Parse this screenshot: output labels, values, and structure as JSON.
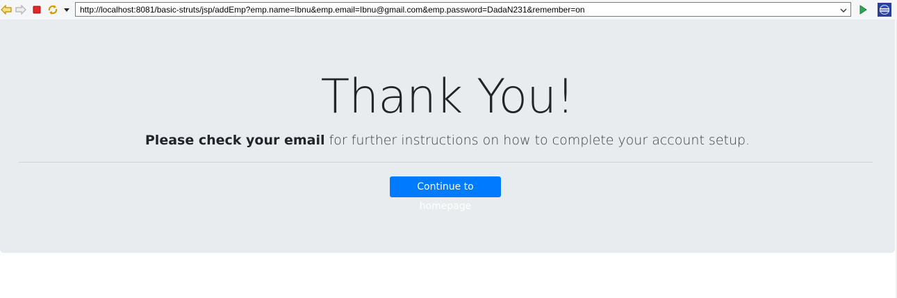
{
  "browser": {
    "url": "http://localhost:8081/basic-struts/jsp/addEmp?emp.name=Ibnu&emp.email=Ibnu@gmail.com&emp.password=DadaN231&remember=on",
    "icons": [
      "back-icon",
      "forward-icon",
      "stop-icon",
      "refresh-icon",
      "dropdown-icon",
      "go-icon",
      "eclipse-icon"
    ]
  },
  "page": {
    "title": "Thank You!",
    "lead_strong": "Please check your email",
    "lead_rest": " for further instructions on how to complete your account setup.",
    "button_label": "Continue to homepage"
  },
  "colors": {
    "jumbotron_bg": "#e9ecef",
    "primary": "#007bff",
    "text": "#212529"
  }
}
